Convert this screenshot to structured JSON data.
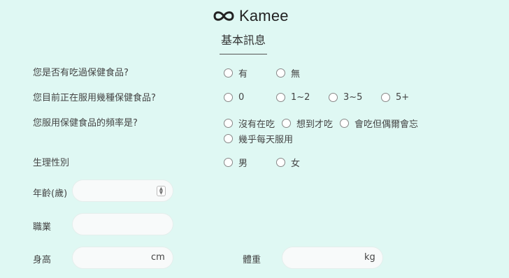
{
  "brand": {
    "name": "Kamee"
  },
  "section": {
    "title": "基本訊息"
  },
  "questions": {
    "q1": {
      "label": "您是否有吃過保健食品?",
      "options": [
        "有",
        "無"
      ]
    },
    "q2": {
      "label": "您目前正在服用幾種保健食品?",
      "options": [
        "0",
        "1~2",
        "3~5",
        "5+"
      ]
    },
    "q3": {
      "label": "您服用保健食品的頻率是?",
      "options": [
        "沒有在吃",
        "想到才吃",
        "會吃但偶爾會忘",
        "幾乎每天服用"
      ]
    },
    "q4": {
      "label": "生理性別",
      "options": [
        "男",
        "女"
      ]
    }
  },
  "fields": {
    "age": {
      "label": "年齡(歲)",
      "value": ""
    },
    "job": {
      "label": "職業",
      "value": ""
    },
    "height": {
      "label": "身高",
      "unit": "cm",
      "value": ""
    },
    "weight": {
      "label": "體重",
      "unit": "kg",
      "value": ""
    }
  },
  "colors": {
    "background": "#dff8f3",
    "input": "#f8fafa"
  },
  "icons": {
    "logo": "infinity-link-icon",
    "radio": "radio-unchecked"
  }
}
